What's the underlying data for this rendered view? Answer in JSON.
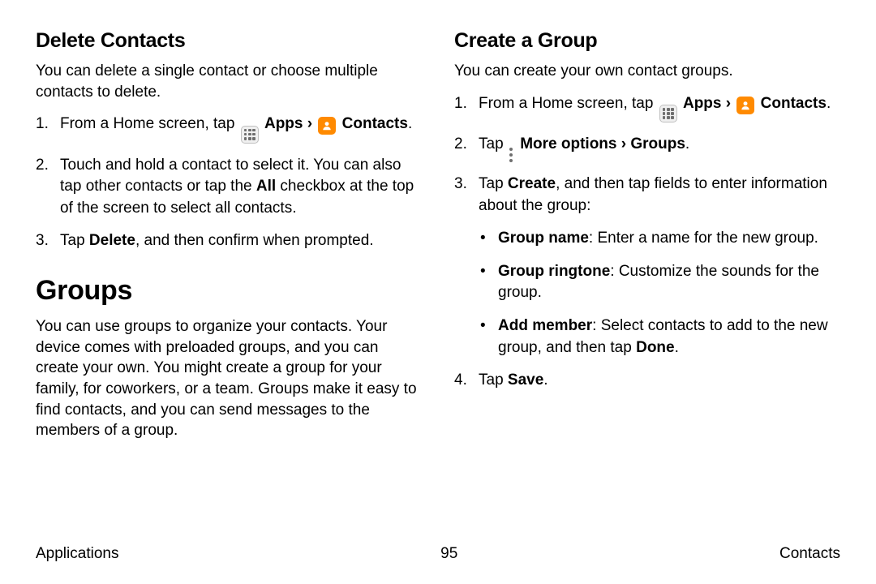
{
  "left": {
    "heading": "Delete Contacts",
    "intro": "You can delete a single contact or choose multiple contacts to delete.",
    "step1_pre": "From a Home screen, tap ",
    "apps": "Apps",
    "chev": " › ",
    "contacts": "Contacts",
    "step1_post": ".",
    "step2_a": "Touch and hold a contact to select it. You can also tap other contacts or tap the ",
    "step2_b": "All",
    "step2_c": " checkbox at the top of the screen to select all contacts.",
    "step3_a": "Tap ",
    "step3_b": "Delete",
    "step3_c": ", and then confirm when prompted.",
    "groups_heading": "Groups",
    "groups_body": "You can use groups to organize your contacts. Your device comes with preloaded groups, and you can create your own. You might create a group for your family, for coworkers, or a team. Groups make it easy to find contacts, and you can send messages to the members of a group."
  },
  "right": {
    "heading": "Create a Group",
    "intro": "You can create your own contact groups.",
    "step1_pre": "From a Home screen, tap ",
    "apps": "Apps",
    "chev": " › ",
    "contacts": "Contacts",
    "step1_post": ".",
    "step2_a": "Tap ",
    "step2_b": "More options › Groups",
    "step2_c": ".",
    "step3_a": "Tap ",
    "step3_b": "Create",
    "step3_c": ", and then tap fields to enter information about the group:",
    "b1_a": "Group name",
    "b1_b": ": Enter a name for the new group.",
    "b2_a": "Group ringtone",
    "b2_b": ": Customize the sounds for the group.",
    "b3_a": "Add member",
    "b3_b": ": Select contacts to add to the new group, and then tap ",
    "b3_c": "Done",
    "b3_d": ".",
    "step4_a": "Tap ",
    "step4_b": "Save",
    "step4_c": "."
  },
  "footer": {
    "left": "Applications",
    "center": "95",
    "right": "Contacts"
  }
}
